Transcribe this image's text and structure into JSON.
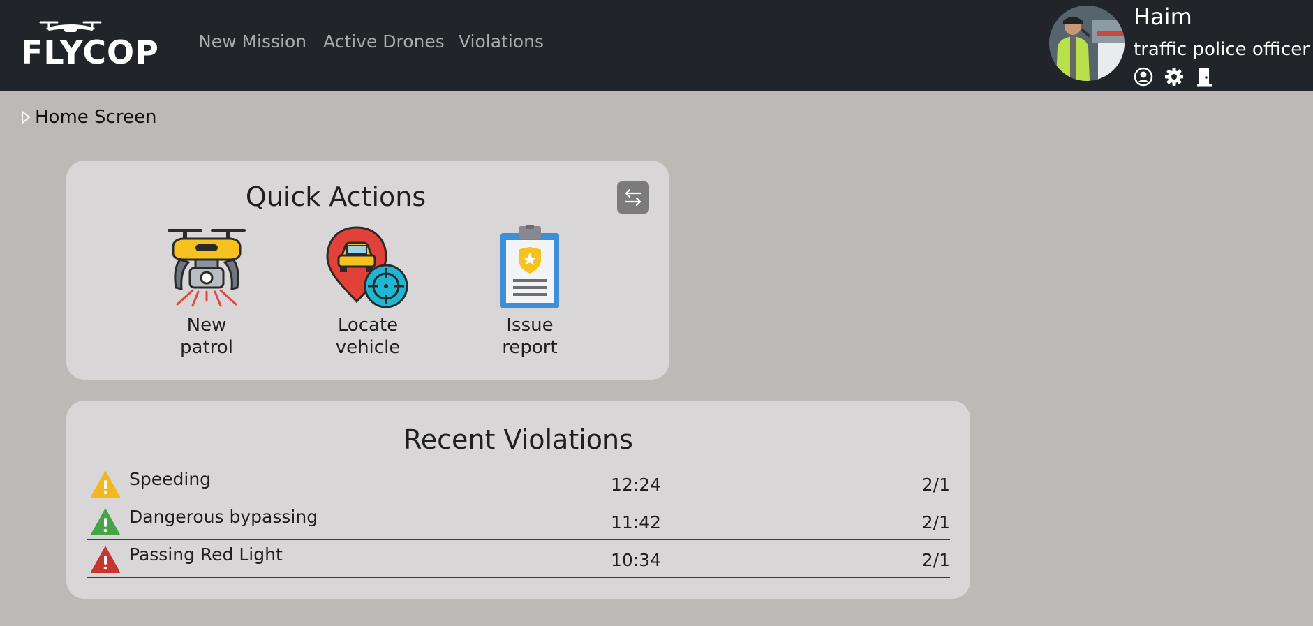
{
  "header": {
    "logo": "FLYCOP",
    "nav": [
      "New Mission",
      "Active Drones",
      "Violations"
    ],
    "user": {
      "name": "Haim",
      "role": "traffic police officer",
      "icons": [
        "user-circle-icon",
        "gear-icon",
        "door-exit-icon"
      ]
    }
  },
  "breadcrumb": "Home Screen",
  "quick_actions": {
    "title": "Quick Actions",
    "swap_icon": "swap-arrows-icon",
    "items": [
      {
        "line1": "New",
        "line2": "patrol",
        "icon": "drone-icon"
      },
      {
        "line1": "Locate",
        "line2": "vehicle",
        "icon": "locate-vehicle-icon"
      },
      {
        "line1": "Issue",
        "line2": "report",
        "icon": "clipboard-report-icon"
      }
    ]
  },
  "recent_violations": {
    "title": "Recent Violations",
    "rows": [
      {
        "type": "Speeding",
        "time": "12:24",
        "date": "2/1",
        "severity_color": "#f2b822"
      },
      {
        "type": "Dangerous bypassing",
        "time": "11:42",
        "date": "2/1",
        "severity_color": "#44a447"
      },
      {
        "type": "Passing Red Light",
        "time": "10:34",
        "date": "2/1",
        "severity_color": "#c8352e"
      }
    ]
  },
  "colors": {
    "navbar": "#212429",
    "page_bg": "#bdb9b7",
    "card_bg": "#d8d6d6",
    "nav_link": "#a9abad"
  }
}
